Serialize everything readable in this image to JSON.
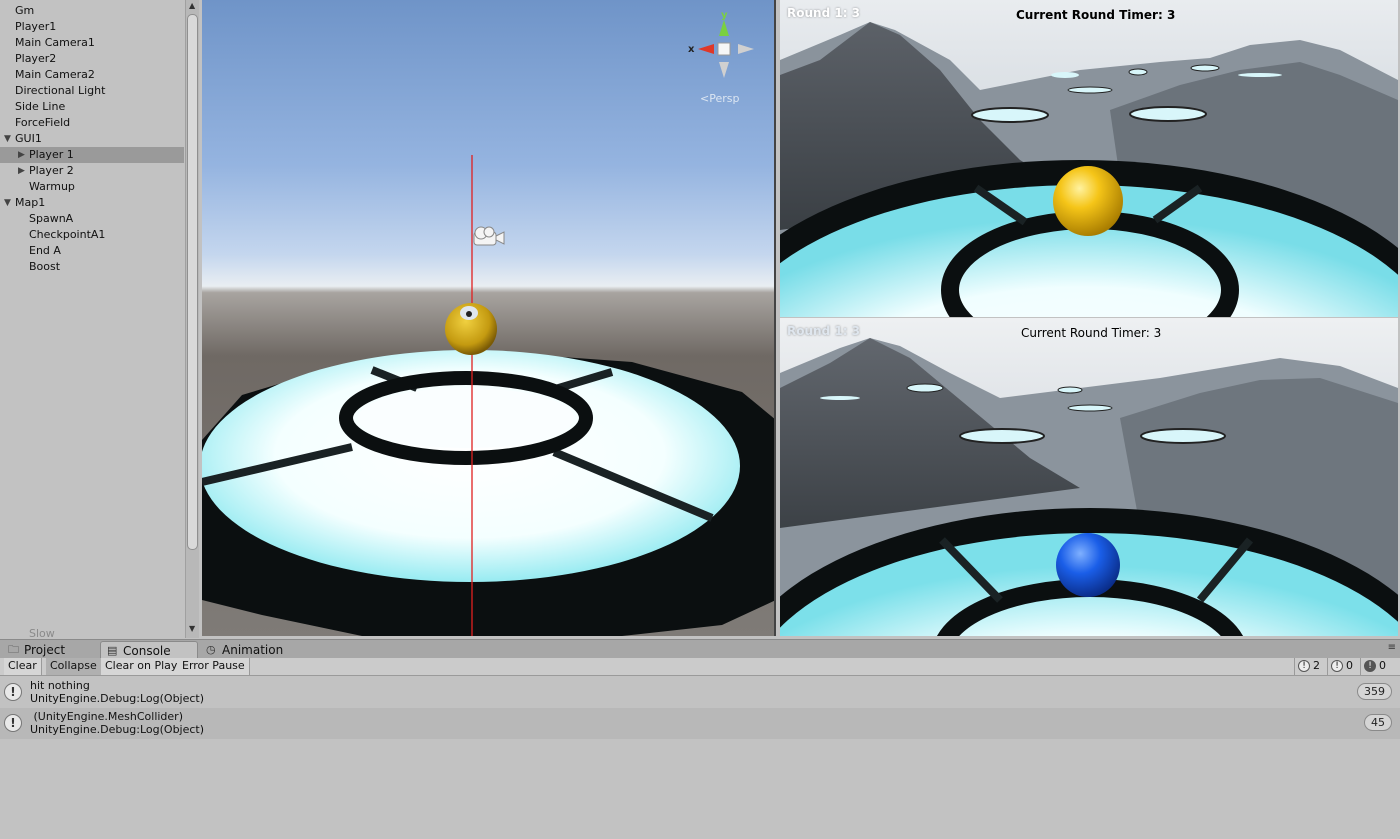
{
  "hierarchy": {
    "items": [
      {
        "label": "Gm",
        "depth": 0,
        "expander": "none",
        "selected": false
      },
      {
        "label": "Player1",
        "depth": 0,
        "expander": "none",
        "selected": false
      },
      {
        "label": "Main Camera1",
        "depth": 0,
        "expander": "none",
        "selected": false
      },
      {
        "label": "Player2",
        "depth": 0,
        "expander": "none",
        "selected": false
      },
      {
        "label": "Main Camera2",
        "depth": 0,
        "expander": "none",
        "selected": false
      },
      {
        "label": "Directional Light",
        "depth": 0,
        "expander": "none",
        "selected": false
      },
      {
        "label": "Side Line",
        "depth": 0,
        "expander": "none",
        "selected": false
      },
      {
        "label": "ForceField",
        "depth": 0,
        "expander": "none",
        "selected": false
      },
      {
        "label": "GUI1",
        "depth": 0,
        "expander": "expanded",
        "selected": false
      },
      {
        "label": "Player 1",
        "depth": 1,
        "expander": "collapsed",
        "selected": true
      },
      {
        "label": "Player 2",
        "depth": 1,
        "expander": "collapsed",
        "selected": false
      },
      {
        "label": "Warmup",
        "depth": 1,
        "expander": "none",
        "selected": false
      },
      {
        "label": "Map1",
        "depth": 0,
        "expander": "expanded",
        "selected": false
      },
      {
        "label": "SpawnA",
        "depth": 1,
        "expander": "none",
        "selected": false
      },
      {
        "label": "CheckpointA1",
        "depth": 1,
        "expander": "none",
        "selected": false
      },
      {
        "label": "End A",
        "depth": 1,
        "expander": "none",
        "selected": false
      },
      {
        "label": "Boost",
        "depth": 1,
        "expander": "none",
        "selected": false
      }
    ],
    "partial_label": "Slow"
  },
  "scene": {
    "gizmo": {
      "x_label": "x",
      "y_label": "y"
    },
    "projection_label": "Persp",
    "colors": {
      "ball": "#e0b41a",
      "ring_glow": "#c6f4f8",
      "ring_dark": "#0b0f10",
      "axis_line": "#e02020"
    }
  },
  "game_top": {
    "round_label": "Round 1: 3",
    "timer_label": "Current Round Timer: 3",
    "ball_color": "#f5c518"
  },
  "game_bottom": {
    "round_label": "Round 1: 3",
    "timer_label": "Current Round Timer: 3",
    "ball_color": "#1a5ee8"
  },
  "tabs": [
    {
      "label": "Project",
      "icon": "folder-icon",
      "active": false
    },
    {
      "label": "Console",
      "icon": "console-icon",
      "active": true
    },
    {
      "label": "Animation",
      "icon": "clock-icon",
      "active": false
    }
  ],
  "console_toolbar": {
    "buttons": [
      {
        "label": "Clear",
        "on": false
      },
      {
        "label": "Collapse",
        "on": true
      },
      {
        "label": "Clear on Play",
        "on": false
      },
      {
        "label": "Error Pause",
        "on": false
      }
    ],
    "counts": {
      "log": "2",
      "warning": "0",
      "error": "0"
    }
  },
  "console_entries": [
    {
      "message": "hit nothing",
      "trace": "UnityEngine.Debug:Log(Object)",
      "count": "359"
    },
    {
      "message": " (UnityEngine.MeshCollider)",
      "trace": "UnityEngine.Debug:Log(Object)",
      "count": "45"
    }
  ]
}
